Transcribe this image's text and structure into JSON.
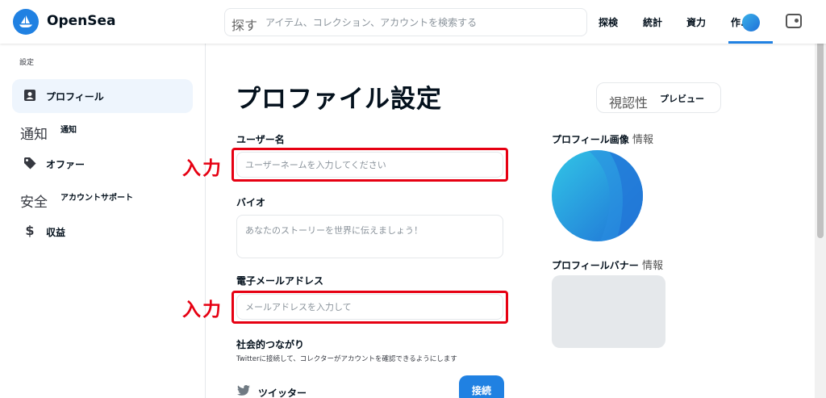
{
  "header": {
    "brand": "OpenSea",
    "search_icon_text": "探す",
    "search_placeholder": "アイテム、コレクション、アカウントを検索する",
    "nav": {
      "explore": "探検",
      "stats": "統計",
      "resources": "資力",
      "create": "作."
    }
  },
  "sidebar": {
    "title": "設定",
    "items": [
      {
        "label": "プロフィール",
        "icon": "id-card-icon"
      },
      {
        "label": "通知",
        "icon_text": "通知"
      },
      {
        "label": "オファー",
        "icon": "tag-icon"
      },
      {
        "label": "アカウントサポート",
        "icon_text": "安全"
      },
      {
        "label": "収益",
        "icon": "dollar-icon"
      }
    ]
  },
  "main": {
    "title": "プロファイル設定",
    "preview_button": {
      "prefix": "視認性",
      "label": "プレビュー"
    },
    "username": {
      "label": "ユーザー名",
      "placeholder": "ユーザーネームを入力してください"
    },
    "bio": {
      "label": "バイオ",
      "placeholder": "あなたのストーリーを世界に伝えましょう！"
    },
    "email": {
      "label": "電子メールアドレス",
      "placeholder": "メールアドレスを入力して"
    },
    "social": {
      "label": "社会的つながり",
      "description": "Twitterに接続して、コレクターがアカウントを確認できるようにします",
      "twitter_label": "ツイッター",
      "connect_button": "接続"
    },
    "annotation": "入力",
    "profile_image": {
      "label": "プロフィール画像",
      "info": "情報"
    },
    "profile_banner": {
      "label": "プロフィールバナー",
      "info": "情報"
    }
  },
  "colors": {
    "accent": "#2081e2",
    "annotation_red": "#e60012",
    "active_bg": "#eef5fd"
  }
}
